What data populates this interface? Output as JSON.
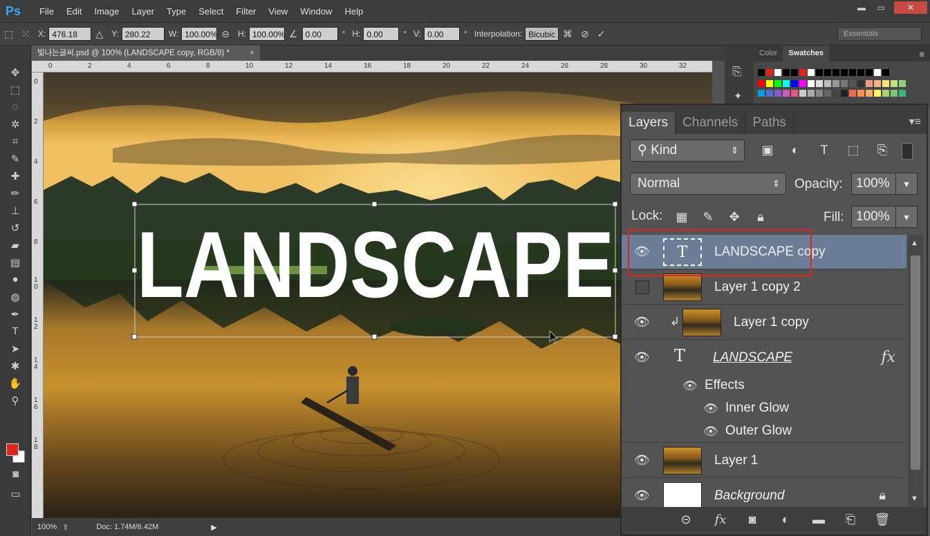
{
  "app": {
    "logo": "Ps"
  },
  "menu": [
    "File",
    "Edit",
    "Image",
    "Layer",
    "Type",
    "Select",
    "Filter",
    "View",
    "Window",
    "Help"
  ],
  "window_controls": {
    "minimize": "▬",
    "maximize": "▭",
    "close": "✕"
  },
  "options": {
    "x_label": "X:",
    "x_value": "476.18 px",
    "y_label": "Y:",
    "y_value": "280.22 px",
    "w_label": "W:",
    "w_value": "100.00%",
    "h_label": "H:",
    "h_value": "100.00%",
    "angle_value": "0.00",
    "deg": "°",
    "hskew_label": "H:",
    "hskew_value": "0.00",
    "vskew_label": "V:",
    "vskew_value": "0.00",
    "interp_label": "Interpolation:",
    "interp_value": "Bicubic",
    "workspace": "Essentials"
  },
  "document": {
    "tab_title": "빛나는글씨.psd @ 100% (LANDSCAPE copy, RGB/8) *",
    "close": "×",
    "canvas_text": "LANDSCAPE",
    "ruler_top": [
      "0",
      "2",
      "4",
      "6",
      "8",
      "10",
      "12",
      "14",
      "16",
      "18",
      "20",
      "22",
      "24",
      "26",
      "28",
      "30",
      "32"
    ],
    "ruler_left": [
      "0",
      "2",
      "4",
      "6",
      "8",
      "1 0",
      "1 2",
      "1 4",
      "1 6",
      "1 8"
    ]
  },
  "status": {
    "zoom": "100%",
    "doc": "Doc: 1.74M/6.42M"
  },
  "color_panel": {
    "tabs": [
      "Color",
      "Swatches"
    ],
    "active": "Swatches"
  },
  "layers_panel": {
    "tabs": [
      "Layers",
      "Channels",
      "Paths"
    ],
    "active_tab": "Layers",
    "kind": "Kind",
    "blend_mode": "Normal",
    "opacity_label": "Opacity:",
    "opacity_value": "100%",
    "lock_label": "Lock:",
    "fill_label": "Fill:",
    "fill_value": "100%",
    "layers": [
      {
        "name": "LANDSCAPE copy",
        "type": "text",
        "visible": true,
        "selected": true
      },
      {
        "name": "Layer 1 copy 2",
        "type": "image",
        "visible": false
      },
      {
        "name": "Layer 1 copy",
        "type": "image",
        "visible": true,
        "clipped": true
      },
      {
        "name": "LANDSCAPE",
        "type": "text",
        "visible": true,
        "fx": "fx"
      },
      {
        "name": "Layer 1",
        "type": "image",
        "visible": true
      },
      {
        "name": "Background",
        "type": "white",
        "visible": true,
        "locked": true
      }
    ],
    "effects_label": "Effects",
    "effect_items": [
      "Inner Glow",
      "Outer Glow"
    ]
  },
  "colors": {
    "accent_red": "#e0241c",
    "selected_row": "#6b7d97",
    "panel_bg": "#535353"
  }
}
